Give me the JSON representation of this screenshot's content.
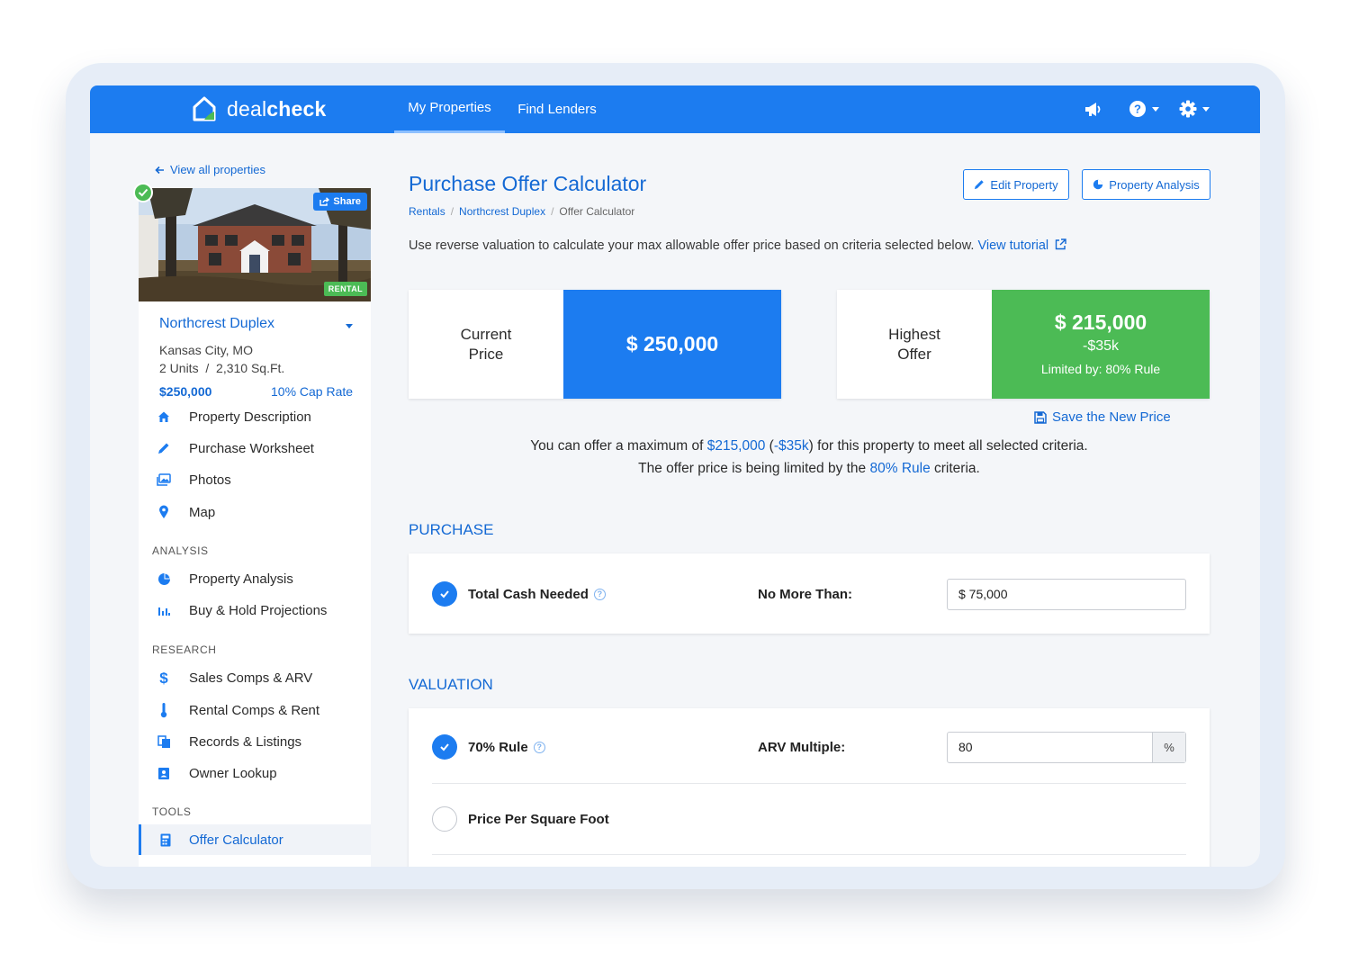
{
  "colors": {
    "accent": "#1c7cf0",
    "link": "#1469d4",
    "success": "#4cbb55",
    "page_bg": "#f4f6f9"
  },
  "nav": {
    "brand_light": "deal",
    "brand_bold": "check",
    "tabs": [
      "My Properties",
      "Find Lenders"
    ],
    "icons": [
      "megaphone-icon",
      "help-icon",
      "gear-icon"
    ]
  },
  "sidebar": {
    "back_label": "View all properties",
    "share_label": "Share",
    "badge": "RENTAL",
    "property_name": "Northcrest Duplex",
    "location": "Kansas City, MO",
    "units": "2 Units",
    "area": "2,310 Sq.Ft.",
    "price": "$250,000",
    "cap_rate": "10% Cap Rate",
    "items": [
      {
        "label": "Property Description",
        "icon": "home-icon"
      },
      {
        "label": "Purchase Worksheet",
        "icon": "pencil-icon"
      },
      {
        "label": "Photos",
        "icon": "photos-icon"
      },
      {
        "label": "Map",
        "icon": "map-pin-icon"
      }
    ],
    "analysis_heading": "ANALYSIS",
    "analysis_items": [
      {
        "label": "Property Analysis",
        "icon": "pie-chart-icon"
      },
      {
        "label": "Buy & Hold Projections",
        "icon": "bar-chart-icon"
      }
    ],
    "research_heading": "RESEARCH",
    "research_items": [
      {
        "label": "Sales Comps & ARV",
        "icon": "dollar-icon"
      },
      {
        "label": "Rental Comps & Rent",
        "icon": "thermometer-icon"
      },
      {
        "label": "Records & Listings",
        "icon": "records-icon"
      },
      {
        "label": "Owner Lookup",
        "icon": "contact-book-icon"
      }
    ],
    "tools_heading": "TOOLS",
    "tools_items": [
      {
        "label": "Offer Calculator",
        "icon": "calculator-icon"
      }
    ]
  },
  "main": {
    "title": "Purchase Offer Calculator",
    "edit_button": "Edit Property",
    "analysis_button": "Property Analysis",
    "breadcrumbs": [
      "Rentals",
      "Northcrest Duplex",
      "Offer Calculator"
    ],
    "intro": "Use reverse valuation to calculate your max allowable offer price based on criteria selected below.",
    "tutorial_link": "View tutorial",
    "current": {
      "caption_1": "Current",
      "caption_2": "Price",
      "value": "$ 250,000"
    },
    "highest": {
      "caption_1": "Highest",
      "caption_2": "Offer",
      "value": "$ 215,000",
      "delta": "-$35k",
      "limit": "Limited by: 80% Rule"
    },
    "save_price": "Save the New Price",
    "summary_1_pre": "You can offer a maximum of",
    "summary_1_amount": "$215,000",
    "summary_1_delta": "-$35k",
    "summary_1_post": "for this property to meet all selected criteria.",
    "summary_2_pre": "The offer price is being limited by the",
    "summary_2_rule": "80% Rule",
    "summary_2_post": "criteria.",
    "purchase_heading": "PURCHASE",
    "purchase_row": {
      "label": "Total Cash Needed",
      "mid": "No More Than:",
      "value": "$ 75,000",
      "checked": true
    },
    "valuation_heading": "VALUATION",
    "valuation_rows": [
      {
        "label": "70% Rule",
        "mid": "ARV Multiple:",
        "value": "80",
        "addon": "%",
        "checked": true
      },
      {
        "label": "Price Per Square Foot",
        "checked": false
      }
    ]
  }
}
